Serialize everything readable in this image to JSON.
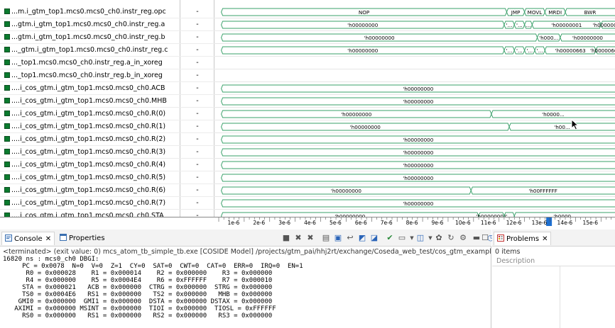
{
  "signals": [
    {
      "name": "...m.i_gtm_top1.mcs0.mcs0_ch0.instr_reg.opc",
      "value": "-"
    },
    {
      "name": "...gtm.i_gtm_top1.mcs0.mcs0_ch0.instr_reg.a",
      "value": "-"
    },
    {
      "name": "...gtm.i_gtm_top1.mcs0.mcs0_ch0.instr_reg.b",
      "value": "-"
    },
    {
      "name": "..._gtm.i_gtm_top1.mcs0.mcs0_ch0.instr_reg.c",
      "value": "-"
    },
    {
      "name": "..._top1.mcs0.mcs0_ch0.instr_reg.a_in_xoreg",
      "value": "-"
    },
    {
      "name": "..._top1.mcs0.mcs0_ch0.instr_reg.b_in_xoreg",
      "value": "-"
    },
    {
      "name": "....i_cos_gtm.i_gtm_top1.mcs0.mcs0_ch0.ACB",
      "value": "-"
    },
    {
      "name": "....i_cos_gtm.i_gtm_top1.mcs0.mcs0_ch0.MHB",
      "value": "-"
    },
    {
      "name": "....i_cos_gtm.i_gtm_top1.mcs0.mcs0_ch0.R(0)",
      "value": "-"
    },
    {
      "name": "....i_cos_gtm.i_gtm_top1.mcs0.mcs0_ch0.R(1)",
      "value": "-"
    },
    {
      "name": "....i_cos_gtm.i_gtm_top1.mcs0.mcs0_ch0.R(2)",
      "value": "-"
    },
    {
      "name": "....i_cos_gtm.i_gtm_top1.mcs0.mcs0_ch0.R(3)",
      "value": "-"
    },
    {
      "name": "....i_cos_gtm.i_gtm_top1.mcs0.mcs0_ch0.R(4)",
      "value": "-"
    },
    {
      "name": "....i_cos_gtm.i_gtm_top1.mcs0.mcs0_ch0.R(5)",
      "value": "-"
    },
    {
      "name": "....i_cos_gtm.i_gtm_top1.mcs0.mcs0_ch0.R(6)",
      "value": "-"
    },
    {
      "name": "....i_cos_gtm.i_gtm_top1.mcs0.mcs0_ch0.R(7)",
      "value": "-"
    },
    {
      "name": "....i_cos_gtm.i_gtm_top1.mcs0.mcs0_ch0.STA",
      "value": "-"
    }
  ],
  "waves": [
    {
      "segments": [
        {
          "start": 0.1,
          "end": 11.3,
          "label": "NOP"
        },
        {
          "start": 11.3,
          "end": 12.0,
          "label": "JMP"
        },
        {
          "start": 12.0,
          "end": 12.8,
          "label": "MOVL"
        },
        {
          "start": 12.8,
          "end": 13.6,
          "label": "MRDI"
        },
        {
          "start": 13.6,
          "end": 20.0,
          "label": "BWR"
        }
      ]
    },
    {
      "segments": [
        {
          "start": 0.1,
          "end": 11.2,
          "label": "'h00000000"
        },
        {
          "start": 11.2,
          "end": 11.6,
          "label": "'..."
        },
        {
          "start": 11.6,
          "end": 12.0,
          "label": "'..."
        },
        {
          "start": 12.0,
          "end": 12.3,
          "label": "..."
        },
        {
          "start": 12.3,
          "end": 15.0,
          "label": "'h00000001"
        },
        {
          "start": 15.0,
          "end": 20.0,
          "label": "'h00000000"
        }
      ]
    },
    {
      "segments": [
        {
          "start": 0.1,
          "end": 12.5,
          "label": "'h00000000"
        },
        {
          "start": 12.5,
          "end": 13.4,
          "label": "'h000..."
        },
        {
          "start": 13.4,
          "end": 20.0,
          "label": "'h00000000"
        }
      ]
    },
    {
      "segments": [
        {
          "start": 0.1,
          "end": 11.2,
          "label": "'h00000000"
        },
        {
          "start": 11.2,
          "end": 11.6,
          "label": "'..."
        },
        {
          "start": 11.6,
          "end": 12.0,
          "label": "'..."
        },
        {
          "start": 12.0,
          "end": 12.4,
          "label": "'..."
        },
        {
          "start": 12.4,
          "end": 12.8,
          "label": "'..."
        },
        {
          "start": 12.8,
          "end": 14.8,
          "label": "'h00000663"
        },
        {
          "start": 14.8,
          "end": 20.0,
          "label": "'h00000662"
        }
      ]
    },
    {
      "segments": []
    },
    {
      "segments": []
    },
    {
      "segments": [
        {
          "start": 0.1,
          "end": 20.0,
          "label": "'h00000000"
        }
      ]
    },
    {
      "segments": [
        {
          "start": 0.1,
          "end": 20.0,
          "label": "'h00000000"
        }
      ]
    },
    {
      "segments": [
        {
          "start": 0.1,
          "end": 10.7,
          "label": "'h00000000"
        },
        {
          "start": 10.7,
          "end": 20.0,
          "label": "'h0000..."
        }
      ]
    },
    {
      "segments": [
        {
          "start": 0.1,
          "end": 11.4,
          "label": "'h00000000"
        },
        {
          "start": 11.4,
          "end": 20.0,
          "label": "'h00..."
        }
      ]
    },
    {
      "segments": [
        {
          "start": 0.1,
          "end": 20.0,
          "label": "'h00000000"
        }
      ]
    },
    {
      "segments": [
        {
          "start": 0.1,
          "end": 20.0,
          "label": "'h00000000"
        }
      ]
    },
    {
      "segments": [
        {
          "start": 0.1,
          "end": 20.0,
          "label": "'h00000000"
        }
      ]
    },
    {
      "segments": [
        {
          "start": 0.1,
          "end": 20.0,
          "label": "'h00000000"
        }
      ]
    },
    {
      "segments": [
        {
          "start": 0.1,
          "end": 9.9,
          "label": "'h00000000"
        },
        {
          "start": 9.9,
          "end": 20.0,
          "label": "'h00FFFFFF"
        }
      ]
    },
    {
      "segments": [
        {
          "start": 0.1,
          "end": 20.0,
          "label": "'h00000000"
        }
      ]
    },
    {
      "segments": [
        {
          "start": 0.1,
          "end": 10.2,
          "label": "'h00000000"
        },
        {
          "start": 10.2,
          "end": 11.2,
          "label": "'h00000001"
        },
        {
          "start": 11.2,
          "end": 11.6,
          "label": "'..."
        },
        {
          "start": 11.6,
          "end": 20.0,
          "label": "'h0000..."
        }
      ]
    }
  ],
  "timeline": {
    "ticks": [
      "1e-6",
      "2e-6",
      "3e-6",
      "4e-6",
      "5e-6",
      "6e-6",
      "7e-6",
      "8e-6",
      "9e-6",
      "10e-6",
      "11e-6",
      "12e-6",
      "13e-6",
      "14e-6",
      "15e-6"
    ],
    "visible_range": [
      0.1,
      20.0
    ],
    "cursor_at": 12.85,
    "colors": {
      "wave": "#3aa06a",
      "grid": "#e6e6e6",
      "cursor": "#1e6fd0"
    }
  },
  "console": {
    "tab_console": "Console",
    "tab_properties": "Properties",
    "header": "<terminated> (exit value: 0) mcs_atom_tb_simple_tb.exe [COSIDE Model] /projects/gtm_pai/hhj2rt/exchange/Coseda_web_test/cos_gtm_example/",
    "lines": [
      "16820 ns : mcs0_ch0 DBGI:",
      "     PC = 0x0078  N=0  V=0  Z=1  CY=0  SAT=0  CWT=0  CAT=0  ERR=0  IRQ=0  EN=1",
      "      R0 = 0x000028    R1 = 0x000014    R2 = 0x000000    R3 = 0x000000",
      "      R4 = 0x000000    R5 = 0x0004E4    R6 = 0xFFFFFF    R7 = 0x000010",
      "     STA = 0x000021   ACB = 0x000000  CTRG = 0x000000  STRG = 0x000000",
      "     TS0 = 0x0004E6   RS1 = 0x000000   TS2 = 0x000000   MHB = 0x000000",
      "    GMI0 = 0x000000  GMI1 = 0x000000  DSTA = 0x000000 DSTAX = 0x000000",
      "   AXIMI = 0x000000 MSINT = 0x000000  TIOI = 0x000000  TIOSL = 0xFFFFFF",
      "     RS0 = 0x000000   RS1 = 0x000000   RS2 = 0x000000   RS3 = 0x000000"
    ]
  },
  "problems": {
    "tab_label": "Problems",
    "count": "0 items",
    "column": "Description"
  }
}
